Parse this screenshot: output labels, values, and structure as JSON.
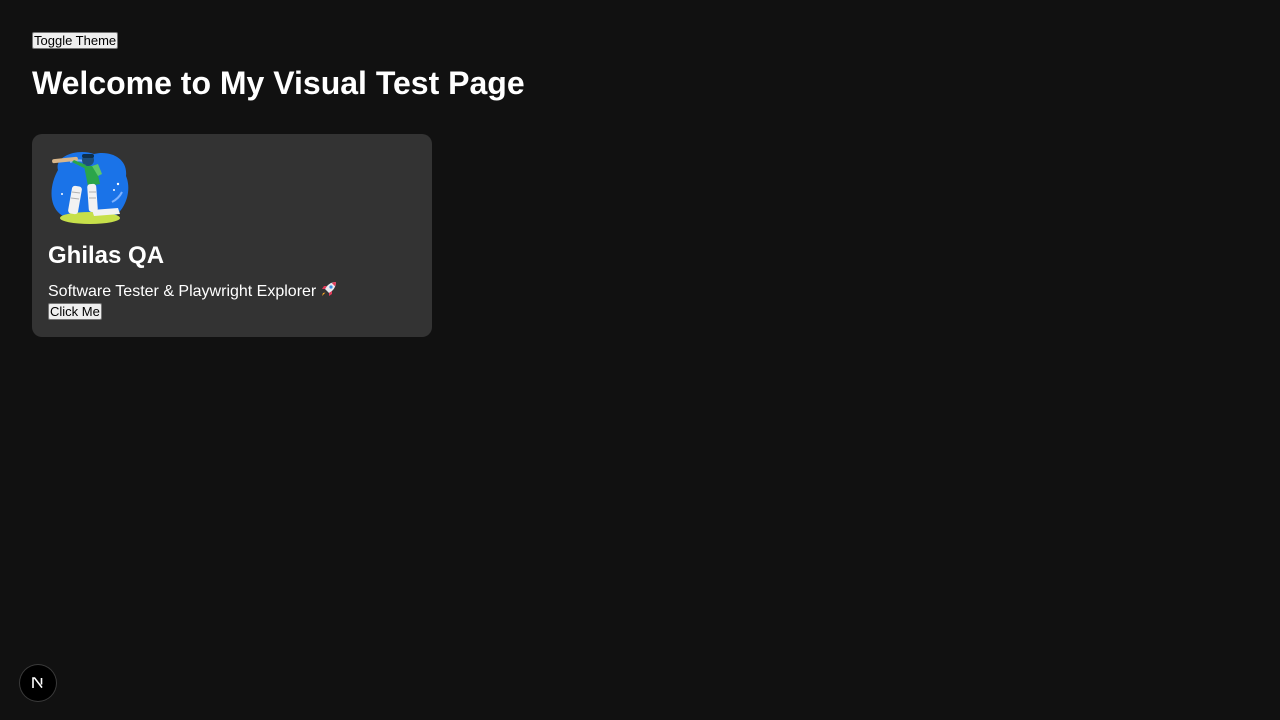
{
  "toolbar": {
    "toggle_theme_label": "Toggle Theme"
  },
  "page": {
    "title": "Welcome to My Visual Test Page"
  },
  "card": {
    "avatar_icon": "cricket-batsman-illustration",
    "name": "Ghilas QA",
    "description": "Software Tester & Playwright Explorer",
    "description_emoji_icon": "rocket-icon",
    "button_label": "Click Me"
  },
  "dev_indicator": {
    "icon": "nextjs-logo-icon"
  },
  "colors": {
    "background": "#111111",
    "card_background": "#333333",
    "text": "#ffffff",
    "avatar_blue": "#1a73e8",
    "avatar_green": "#c7e04a"
  }
}
